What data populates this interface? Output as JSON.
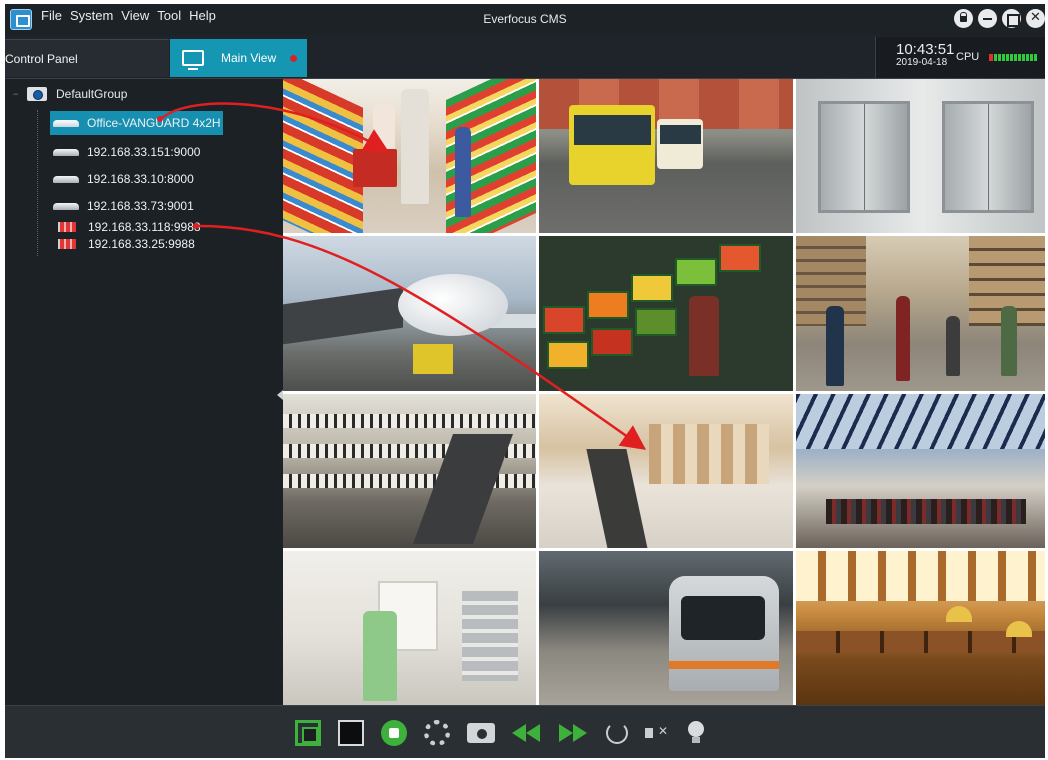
{
  "window": {
    "title": "Everfocus CMS",
    "menu": [
      "File",
      "System",
      "View",
      "Tool",
      "Help"
    ]
  },
  "tabs": [
    {
      "label": "Control Panel",
      "icon": "control-panel-icon",
      "active": false
    },
    {
      "label": "Main View",
      "icon": "monitor-icon",
      "active": true
    }
  ],
  "status": {
    "time": "10:43:51",
    "date": "2019-04-18",
    "cpu_label": "CPU"
  },
  "tree": {
    "root": "DefaultGroup",
    "devices": [
      {
        "label": "Office-VANGUARD 4x2H",
        "type": "dvr",
        "selected": true
      },
      {
        "label": "192.168.33.151:9000",
        "type": "dvr"
      },
      {
        "label": "192.168.33.10:8000",
        "type": "dvr"
      },
      {
        "label": "192.168.33.73:9001",
        "type": "dvr"
      },
      {
        "label": "192.168.33.118:9988",
        "type": "flag"
      },
      {
        "label": "192.168.33.25:9988",
        "type": "flag"
      }
    ]
  },
  "grid": {
    "columns": 3,
    "rows": 4,
    "scenes": [
      "supermarket-aisle",
      "bus-street",
      "elevator-lobby",
      "airport-apron",
      "produce-market",
      "pedestrian-street",
      "mall-atrium",
      "mall-escalator",
      "mall-glass-roof",
      "hospital-corridor",
      "subway-platform",
      "library-reading-room"
    ]
  },
  "toolbar": {
    "buttons": [
      "fullscreen",
      "single-view",
      "record",
      "film",
      "snapshot",
      "rewind",
      "fast-forward",
      "loop",
      "mute",
      "light"
    ]
  },
  "colors": {
    "accent": "#1597b4",
    "tab_close_dot": "#d6232a",
    "control_green": "#3db13b",
    "annotation_arrow": "#e02020"
  }
}
